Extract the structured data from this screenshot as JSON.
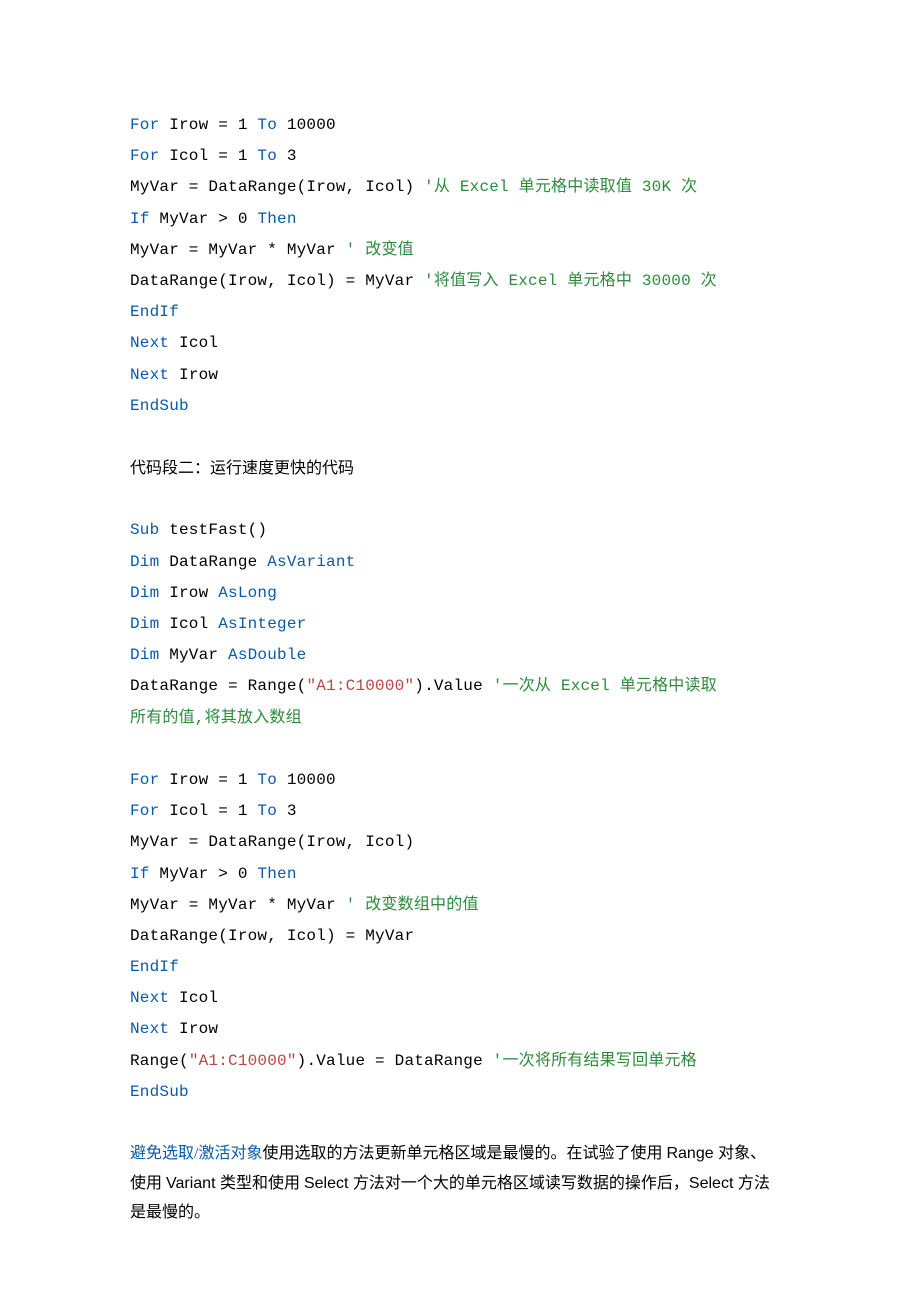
{
  "block1": {
    "l1_kw": "For",
    "l1_rest": " Irow = 1 ",
    "l1_to": "To",
    "l1_end": " 10000",
    "l2_kw": "For",
    "l2_rest": " Icol = 1 ",
    "l2_to": "To",
    "l2_end": " 3",
    "l3_a": "MyVar = DataRange(Irow, Icol)  ",
    "l3_c": "'从 Excel 单元格中读取值 30K 次",
    "l4_if": "If",
    "l4_mid": " MyVar > 0 ",
    "l4_then": "Then",
    "l5_a": "MyVar = MyVar * MyVar ",
    "l5_c": "' 改变值",
    "l6_a": "DataRange(Irow, Icol) = MyVar ",
    "l6_c": "'将值写入 Excel 单元格中 30000 次",
    "l7": "EndIf",
    "l8_kw": "Next",
    "l8_rest": " Icol",
    "l9_kw": "Next",
    "l9_rest": " Irow",
    "l10": "EndSub"
  },
  "prose1": "代码段二：运行速度更快的代码",
  "block2": {
    "l1_kw": "Sub",
    "l1_rest": " testFast()",
    "l2_kw": "Dim",
    "l2_mid": " DataRange ",
    "l2_kw2": "AsVariant",
    "l3_kw": "Dim",
    "l3_mid": " Irow ",
    "l3_kw2": "AsLong",
    "l4_kw": "Dim",
    "l4_mid": " Icol ",
    "l4_kw2": "AsInteger",
    "l5_kw": "Dim",
    "l5_mid": " MyVar ",
    "l5_kw2": "AsDouble",
    "l6_a": "DataRange = Range(",
    "l6_str": "\"A1:C10000\"",
    "l6_b": ").Value ",
    "l6_c1": "'一次从 Excel 单元格中读取",
    "l6_c2": "所有的值,将其放入数组",
    "l7_kw": "For",
    "l7_rest": " Irow = 1 ",
    "l7_to": "To",
    "l7_end": " 10000",
    "l8_kw": "For",
    "l8_rest": " Icol = 1 ",
    "l8_to": "To",
    "l8_end": " 3",
    "l9_a": "MyVar = DataRange(Irow, Icol)",
    "l10_if": "If",
    "l10_mid": " MyVar > 0 ",
    "l10_then": "Then",
    "l11_a": "MyVar = MyVar * MyVar ",
    "l11_c": "' 改变数组中的值",
    "l12_a": "DataRange(Irow, Icol) = MyVar",
    "l13": "EndIf",
    "l14_kw": "Next",
    "l14_rest": " Icol",
    "l15_kw": "Next",
    "l15_rest": " Irow",
    "l16_a": "Range(",
    "l16_str": "\"A1:C10000\"",
    "l16_b": ").Value = DataRange ",
    "l16_c": "'一次将所有结果写回单元格",
    "l17": "EndSub"
  },
  "prose2": {
    "kw": "避免选取/激活对象",
    "rest1a": "使用选取的方法更新单元格区域是最慢的。在试验了使用 ",
    "rest1b_sans": "Range ",
    "rest1c": "对象、",
    "rest2a": "使用 ",
    "rest2b_sans": "Variant ",
    "rest2c": "类型和使用 ",
    "rest2d_sans": "Select ",
    "rest2e": "方法对一个大的单元格区域读写数据的操作后，",
    "rest2f_sans": "Select ",
    "rest2g": "方法",
    "rest3": "是最慢的。"
  }
}
